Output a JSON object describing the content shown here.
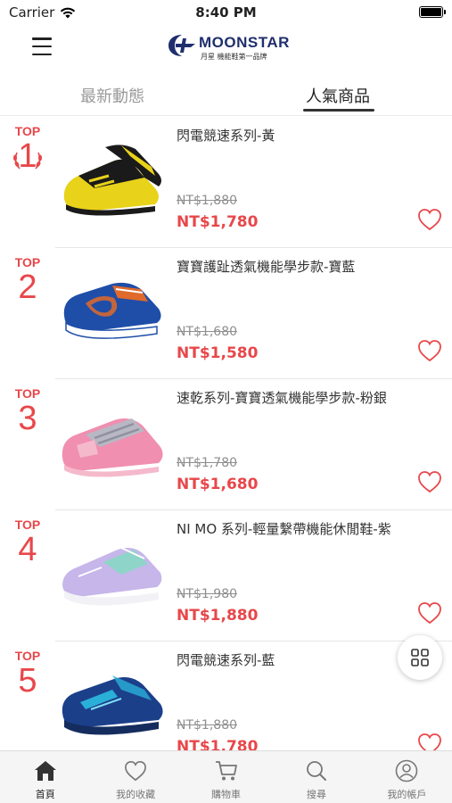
{
  "status_bar": {
    "carrier": "Carrier",
    "time": "8:40 PM"
  },
  "header": {
    "logo_text": "MOONSTAR",
    "logo_subtext": "月星  機能鞋第一品牌",
    "brand_color": "#1f2f6d"
  },
  "tabs": [
    {
      "label": "最新動態",
      "active": false
    },
    {
      "label": "人氣商品",
      "active": true
    }
  ],
  "accent_color": "#e8474a",
  "products": [
    {
      "rank_label": "TOP",
      "rank": "1",
      "name": "閃電競速系列-黃",
      "original_price": "NT$1,880",
      "price": "NT$1,780",
      "shoe_colors": [
        "#e8d21a",
        "#1a1a1a"
      ]
    },
    {
      "rank_label": "TOP",
      "rank": "2",
      "name": "寶寶護趾透氣機能學步款-寶藍",
      "original_price": "NT$1,680",
      "price": "NT$1,580",
      "shoe_colors": [
        "#1f4ea8",
        "#e06a2a"
      ]
    },
    {
      "rank_label": "TOP",
      "rank": "3",
      "name": "速乾系列-寶寶透氣機能學步款-粉銀",
      "original_price": "NT$1,780",
      "price": "NT$1,680",
      "shoe_colors": [
        "#f08fb0",
        "#b8b8c4"
      ]
    },
    {
      "rank_label": "TOP",
      "rank": "4",
      "name": "NI MO 系列-輕量繫帶機能休閒鞋-紫",
      "original_price": "NT$1,980",
      "price": "NT$1,880",
      "shoe_colors": [
        "#c6b6ea",
        "#8fd4c8"
      ]
    },
    {
      "rank_label": "TOP",
      "rank": "5",
      "name": "閃電競速系列-藍",
      "original_price": "NT$1,880",
      "price": "NT$1,780",
      "shoe_colors": [
        "#1c3f8a",
        "#2ab0d8"
      ]
    }
  ],
  "bottom_nav": [
    {
      "label": "首頁",
      "icon": "home-icon",
      "active": true
    },
    {
      "label": "我的收藏",
      "icon": "heart-icon",
      "active": false
    },
    {
      "label": "購物車",
      "icon": "cart-icon",
      "active": false
    },
    {
      "label": "搜尋",
      "icon": "search-icon",
      "active": false
    },
    {
      "label": "我的帳戶",
      "icon": "account-icon",
      "active": false
    }
  ]
}
